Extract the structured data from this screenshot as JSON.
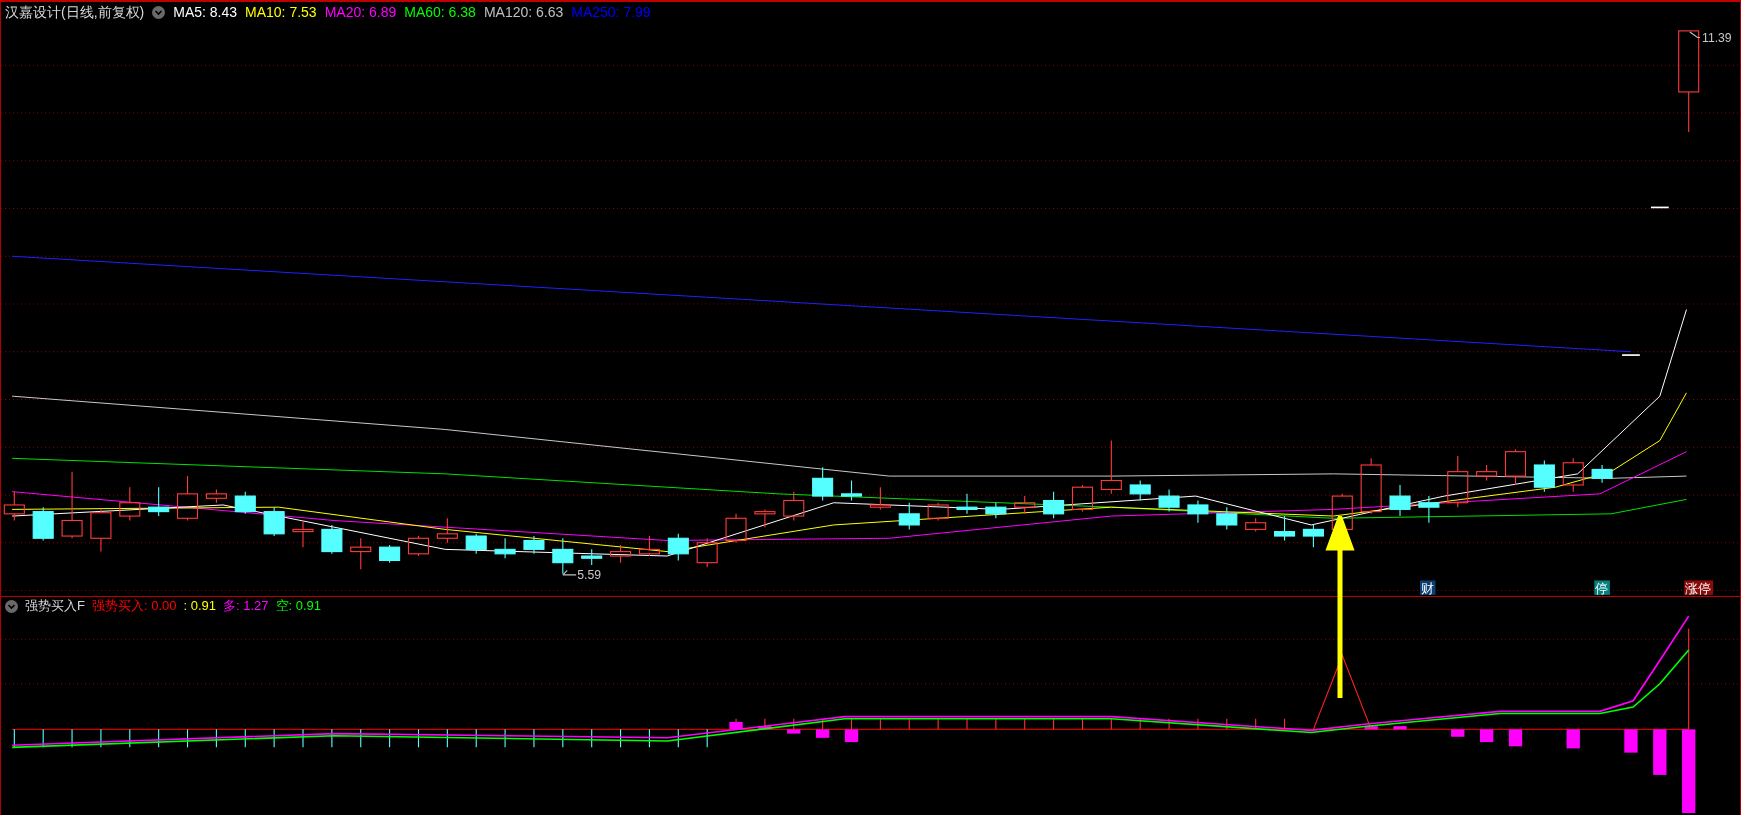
{
  "header": {
    "title": "汉嘉设计(日线,前复权)",
    "ma_items": [
      {
        "label": "MA5: 8.43",
        "color": "#ffffff"
      },
      {
        "label": "MA10: 7.53",
        "color": "#ffff00"
      },
      {
        "label": "MA20: 6.89",
        "color": "#ff00ff"
      },
      {
        "label": "MA60: 6.38",
        "color": "#00ff00"
      },
      {
        "label": "MA120: 6.63",
        "color": "#c0c0c0"
      },
      {
        "label": "MA250: 7.99",
        "color": "#0000ff"
      }
    ]
  },
  "price_labels": {
    "high": "11.39",
    "low": "5.59"
  },
  "signal_tags": [
    {
      "label": "财",
      "color": "#0a3f73"
    },
    {
      "label": "停",
      "color": "#078080"
    },
    {
      "label": "涨停",
      "color": "#8b0a0a"
    }
  ],
  "indicator": {
    "name": "强势买入F",
    "items": [
      {
        "label": "强势买入: 0.00",
        "color": "#ff0000"
      },
      {
        "label": ": 0.91",
        "color": "#ffff00"
      },
      {
        "label": "多: 1.27",
        "color": "#ff00ff"
      },
      {
        "label": "空: 0.91",
        "color": "#00ff00"
      }
    ]
  }
}
